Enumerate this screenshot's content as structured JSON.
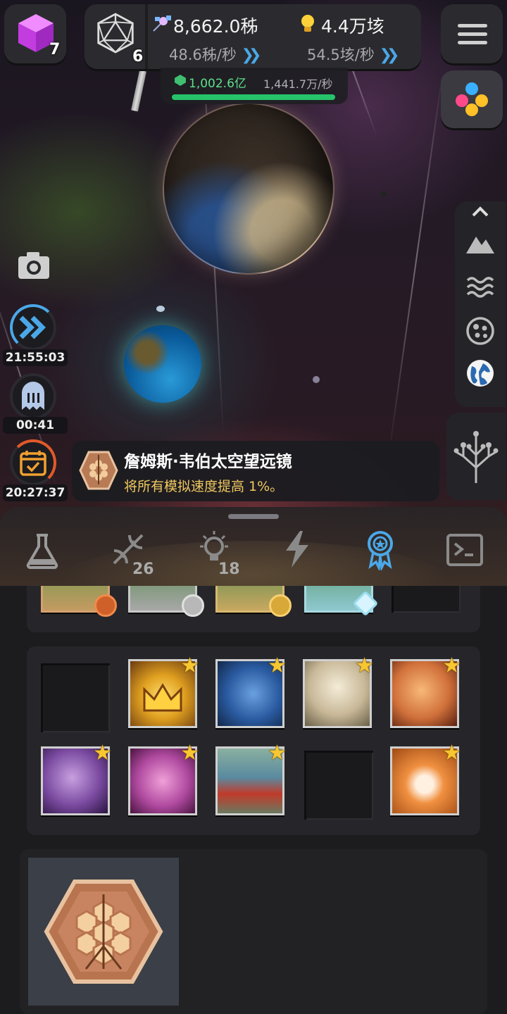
{
  "hud": {
    "cube_count": "7",
    "d20_count": "6",
    "resource_1": {
      "value": "8,662.0秭",
      "rate": "48.6秭/秒",
      "icon": "satellite-icon"
    },
    "resource_2": {
      "value": "4.4万垓",
      "rate": "54.5垓/秒",
      "icon": "lightbulb-icon"
    },
    "sub_resource": {
      "value": "1,002.6亿",
      "rate": "1,441.7万/秒",
      "icon": "green-gem-icon",
      "progress": 1.0
    }
  },
  "timers": [
    {
      "name": "speed-boost",
      "icon": "fast-forward-icon",
      "time": "21:55:03"
    },
    {
      "name": "ghost",
      "icon": "ghost-icon",
      "time": "00:41"
    },
    {
      "name": "calendar",
      "icon": "calendar-check-icon",
      "time": "20:27:37"
    }
  ],
  "toast": {
    "title": "詹姆斯·韦伯太空望远镜",
    "description": "将所有模拟速度提高 1%。",
    "icon": "jwst-hexagon-icon"
  },
  "tabs": [
    {
      "name": "science",
      "icon": "flask-icon",
      "count": ""
    },
    {
      "name": "dna",
      "icon": "dna-icon",
      "count": "26"
    },
    {
      "name": "ideas",
      "icon": "lightbulb-icon",
      "count": "18"
    },
    {
      "name": "power",
      "icon": "lightning-icon",
      "count": ""
    },
    {
      "name": "achievements",
      "icon": "award-ribbon-icon",
      "count": "",
      "active": true
    },
    {
      "name": "console",
      "icon": "terminal-icon",
      "count": ""
    }
  ],
  "tools": [
    "mountain-icon",
    "waves-icon",
    "cells-icon",
    "globe-icon"
  ],
  "colors": {
    "accent_blue": "#4aa8e8",
    "progress_green": "#26c46a",
    "toast_desc_gold": "#f0c860",
    "star_gold": "#f7c630"
  },
  "medals": [
    "bronze",
    "silver",
    "gold",
    "diamond"
  ],
  "collection": [
    {
      "slot": "empty"
    },
    {
      "slot": "crown",
      "starred": true
    },
    {
      "slot": "blue-elephant",
      "starred": true
    },
    {
      "slot": "darwin-statue",
      "starred": true
    },
    {
      "slot": "orange-explorer",
      "starred": true
    },
    {
      "slot": "purple-dinosaur",
      "starred": true
    },
    {
      "slot": "pink-dolphin",
      "starred": true
    },
    {
      "slot": "birds-fish",
      "starred": true
    },
    {
      "slot": "empty"
    },
    {
      "slot": "shiba-dog",
      "starred": true
    }
  ]
}
